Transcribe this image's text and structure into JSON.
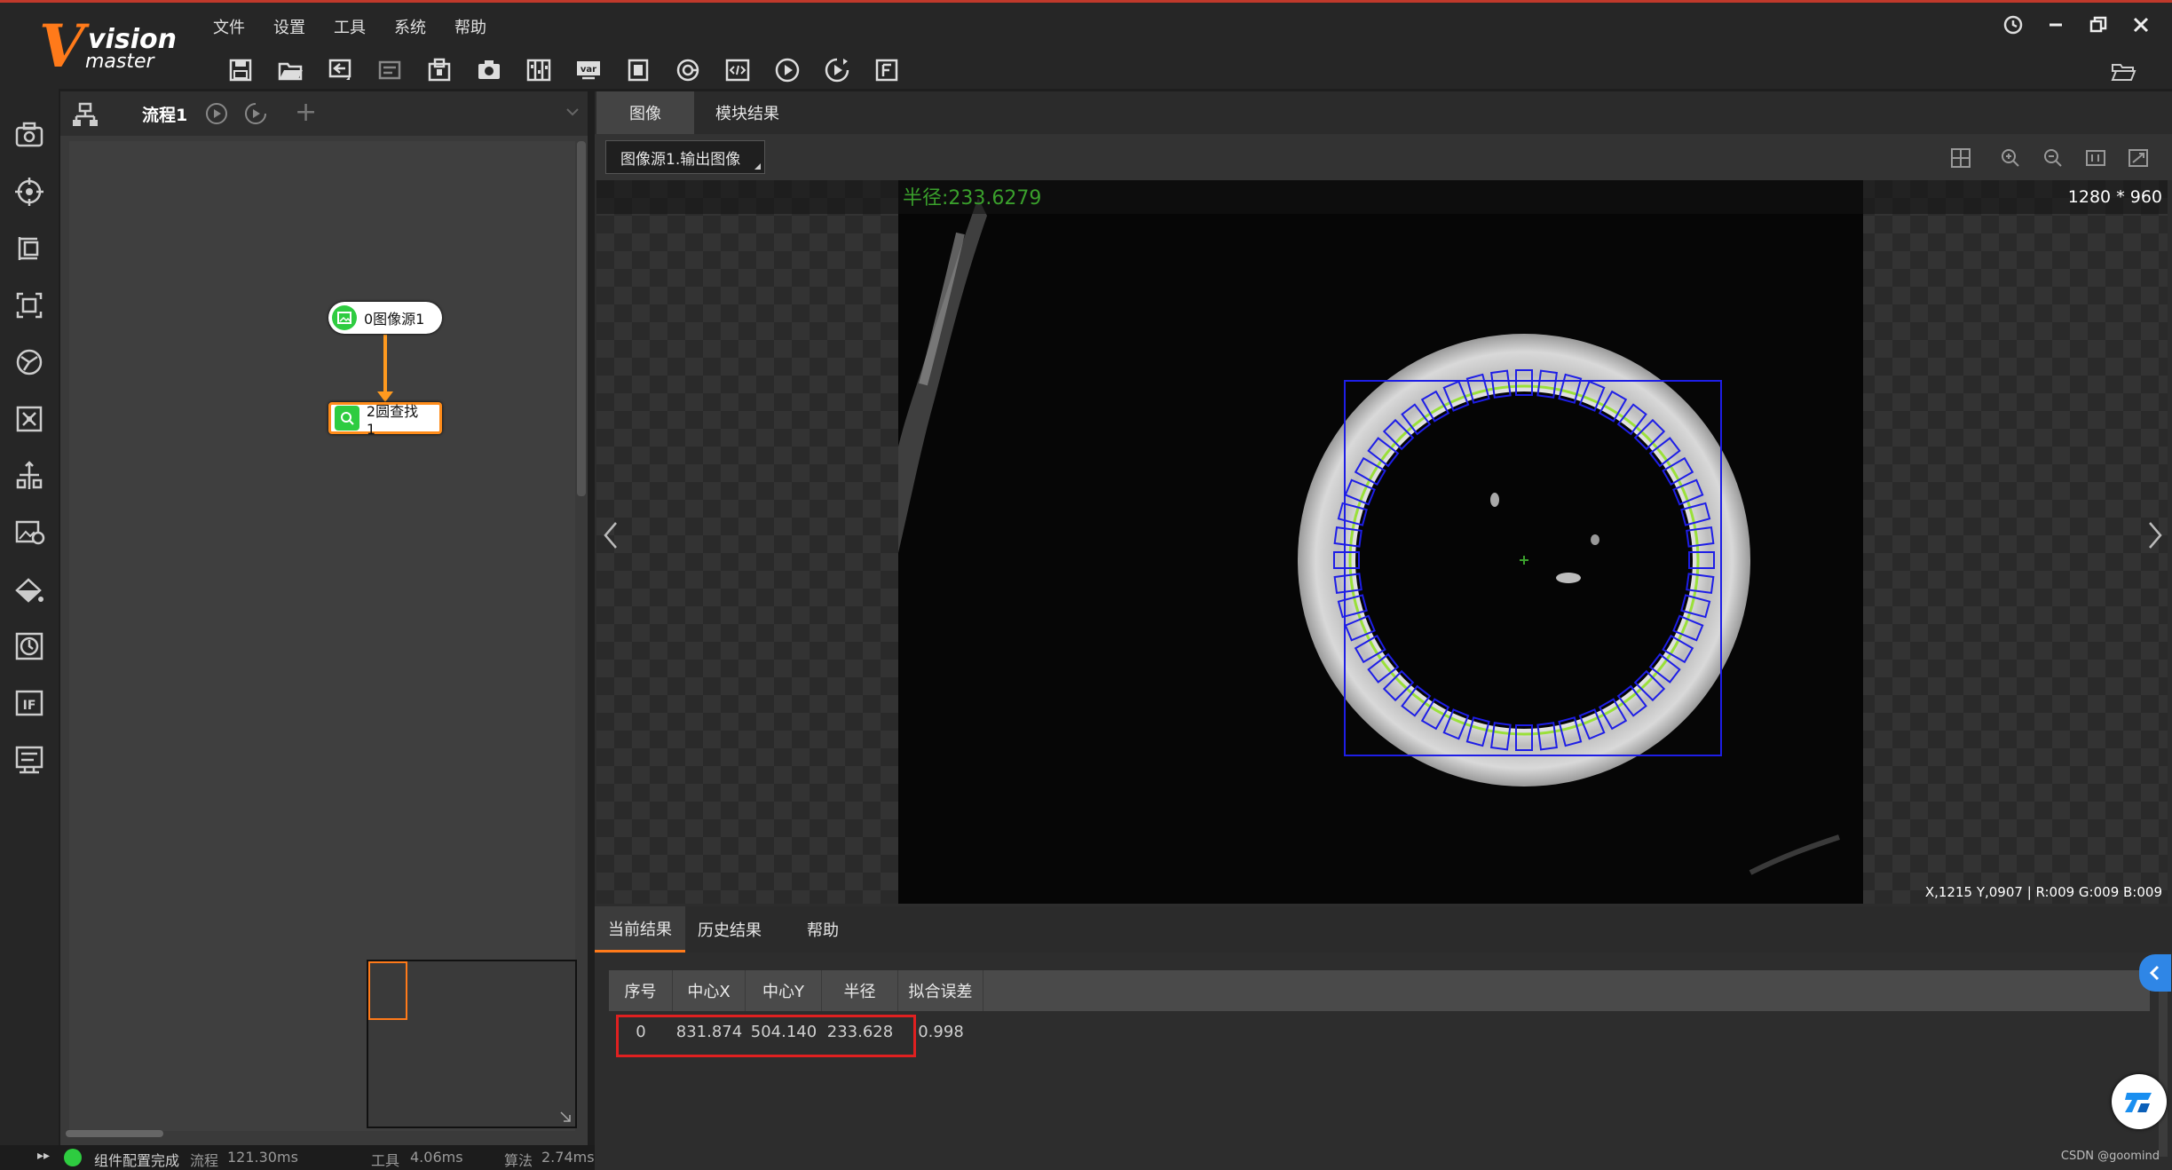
{
  "app": {
    "logo_main": "vision",
    "logo_sub": "master",
    "logo_letter": "V"
  },
  "menu": [
    "文件",
    "设置",
    "工具",
    "系统",
    "帮助"
  ],
  "toolbar_icons": [
    "save-icon",
    "open-folder-icon",
    "import-icon",
    "export-icon",
    "lock-icon",
    "camera-icon",
    "panel-icon",
    "var-icon",
    "device-icon",
    "global-script-icon",
    "code-icon",
    "run-once-icon",
    "run-loop-icon",
    "font-icon"
  ],
  "rail_icons": [
    "camera-icon",
    "locate-icon",
    "measure-icon",
    "recognize-icon",
    "calibrate-icon",
    "contrast-icon",
    "align-icon",
    "image-process-icon",
    "color-icon",
    "defect-icon",
    "logic-if-icon",
    "communication-icon"
  ],
  "flow": {
    "tab_title": "流程1",
    "add_symbol": "+",
    "nodes": [
      {
        "label": "0图像源1",
        "icon": "image-source-icon"
      },
      {
        "label": "2圆查找1",
        "icon": "circle-find-icon"
      }
    ]
  },
  "status": {
    "text": "组件配置完成",
    "flow_label": "流程",
    "flow_time": "121.30ms",
    "tool_label": "工具",
    "tool_time": "4.06ms",
    "algo_label": "算法",
    "algo_time": "2.74ms"
  },
  "image_panel": {
    "tabs": [
      "图像",
      "模块结果"
    ],
    "source_select": "图像源1.输出图像",
    "radius_overlay": "半径:233.6279",
    "image_size": "1280 * 960",
    "coord_readout": "X,1215  Y,0907  |  R:009  G:009  B:009"
  },
  "results": {
    "tabs": [
      "当前结果",
      "历史结果",
      "帮助"
    ],
    "columns": [
      "序号",
      "中心X",
      "中心Y",
      "半径",
      "拟合误差"
    ],
    "rows": [
      {
        "index": "0",
        "cx": "831.874",
        "cy": "504.140",
        "r": "233.628",
        "err": "0.998"
      }
    ]
  },
  "watermark": "CSDN @goomind",
  "colors": {
    "accent": "#ff7a1a",
    "node_ok": "#2ecc40",
    "highlight": "#e02020",
    "overlay_green": "#3aa02c",
    "caliper_blue": "#1e1ee6"
  }
}
